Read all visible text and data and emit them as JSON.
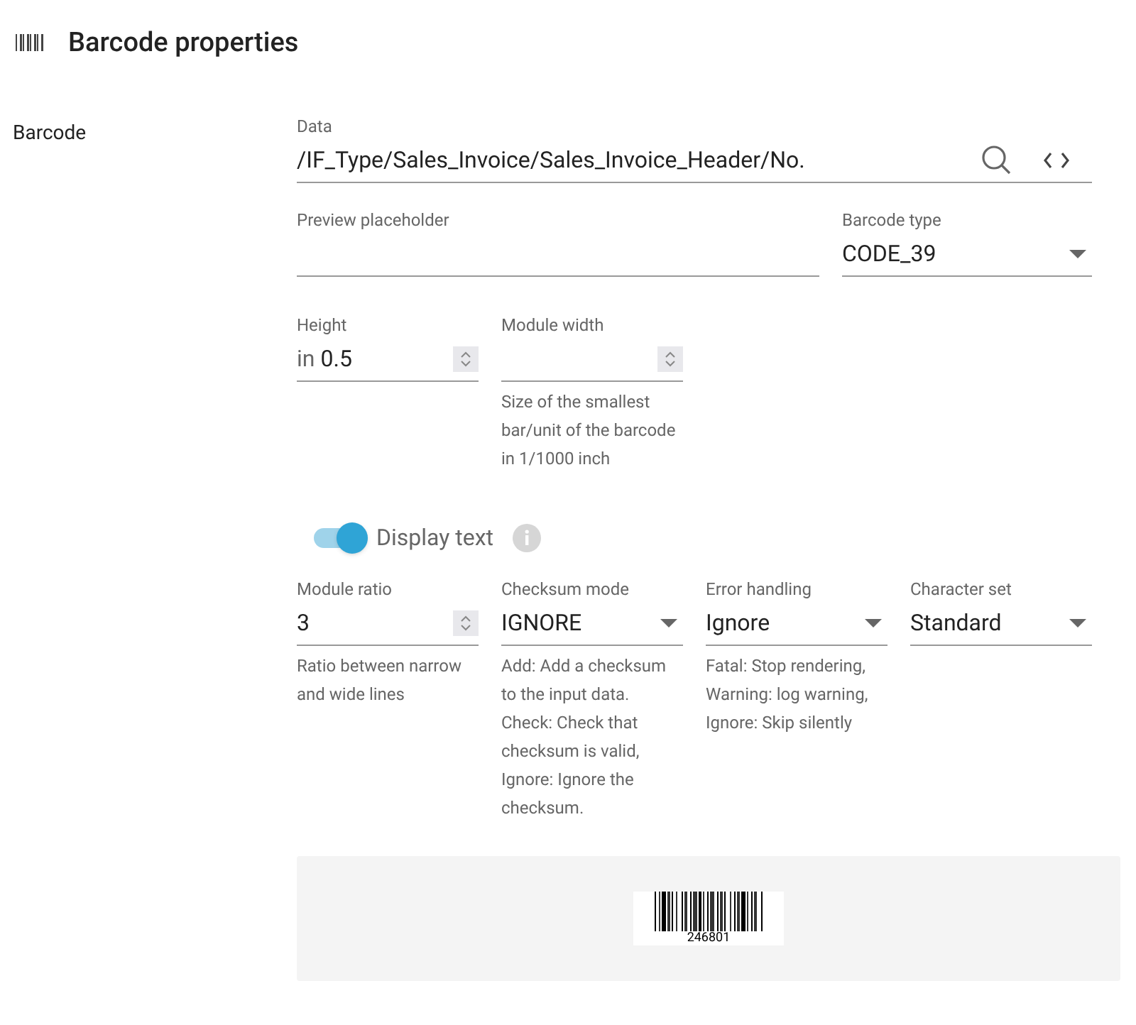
{
  "header": {
    "title": "Barcode properties"
  },
  "section": {
    "label": "Barcode"
  },
  "data_field": {
    "label": "Data",
    "value": "/IF_Type/Sales_Invoice/Sales_Invoice_Header/No."
  },
  "preview_placeholder": {
    "label": "Preview placeholder"
  },
  "barcode_type": {
    "label": "Barcode type",
    "value": "CODE_39"
  },
  "size_fields": [
    {
      "kind": "number",
      "label": "Height",
      "prefix": "in",
      "value": "0.5"
    },
    {
      "kind": "number",
      "label": "Module width",
      "help": "Size of the smallest bar/unit of the barcode in 1/1000 inch"
    }
  ],
  "display_text": {
    "label": "Display text",
    "on": true
  },
  "options": [
    {
      "kind": "number",
      "label": "Module ratio",
      "value": "3",
      "help": "Ratio between narrow and wide lines"
    },
    {
      "kind": "select",
      "label": "Checksum mode",
      "value": "IGNORE",
      "help": "Add: Add a checksum to the input data. Check: Check that checksum is valid, Ignore: Ignore the checksum."
    },
    {
      "kind": "select",
      "label": "Error handling",
      "value": "Ignore",
      "help": "Fatal: Stop rendering, Warning: log warning, Ignore: Skip silently"
    },
    {
      "kind": "select",
      "label": "Character set",
      "value": "Standard"
    }
  ],
  "preview": {
    "caption": "246801"
  }
}
